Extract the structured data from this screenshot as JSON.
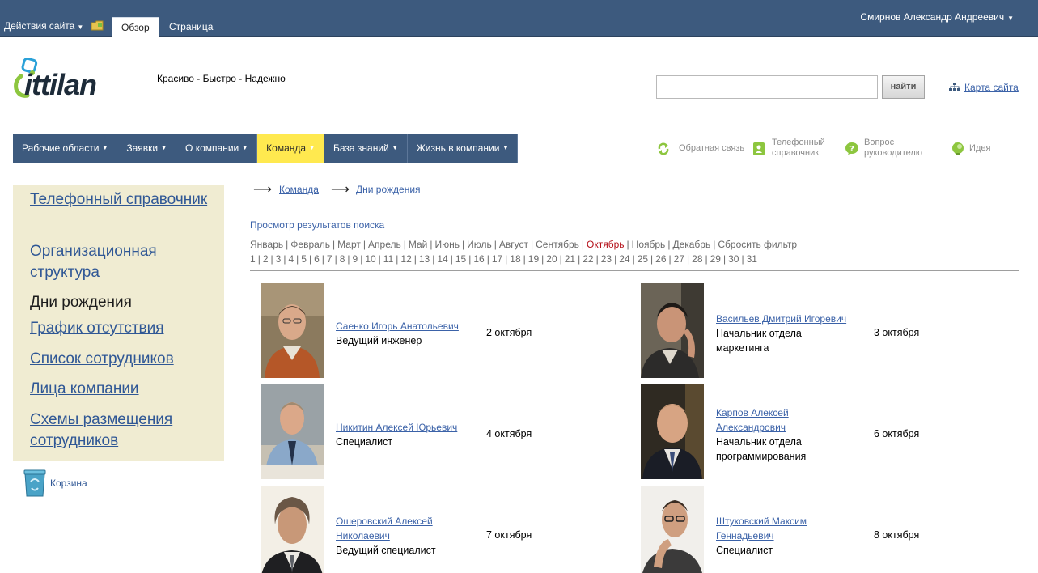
{
  "ribbon": {
    "site_actions": "Действия сайта",
    "tabs": [
      "Обзор",
      "Страница"
    ],
    "user": "Смирнов Александр Андреевич"
  },
  "header": {
    "logo_text": "ittilan",
    "slogan": "Красиво - Быстро - Надежно",
    "search_placeholder": "",
    "search_button": "найти",
    "sitemap": "Карта сайта"
  },
  "nav": {
    "items": [
      "Рабочие области",
      "Заявки",
      "О компании",
      "Команда",
      "База знаний",
      "Жизнь в компании"
    ],
    "active": "Команда"
  },
  "quick_links": [
    {
      "label": "Обратная связь",
      "icon": "recycle-arrows-icon"
    },
    {
      "label": "Телефонный справочник",
      "icon": "phonebook-icon"
    },
    {
      "label": "Вопрос руководителю",
      "icon": "question-bubble-icon"
    },
    {
      "label": "Идея",
      "icon": "idea-bulb-icon"
    }
  ],
  "sidebar": {
    "items": [
      "Телефонный справочник",
      "Организационная структура",
      "Дни рождения",
      "График отсутствия",
      "Список сотрудников",
      "Лица компании",
      "Схемы размещения сотрудников"
    ],
    "current": "Дни рождения",
    "trash": "Корзина"
  },
  "breadcrumb": [
    "Команда",
    "Дни рождения"
  ],
  "filter": {
    "title": "Просмотр результатов поиска",
    "months": [
      "Январь",
      "Февраль",
      "Март",
      "Апрель",
      "Май",
      "Июнь",
      "Июль",
      "Август",
      "Сентябрь",
      "Октябрь",
      "Ноябрь",
      "Декабрь"
    ],
    "selected_month": "Октябрь",
    "reset": "Сбросить фильтр",
    "days": [
      "1",
      "2",
      "3",
      "4",
      "5",
      "6",
      "7",
      "8",
      "9",
      "10",
      "11",
      "12",
      "13",
      "14",
      "15",
      "16",
      "17",
      "18",
      "19",
      "20",
      "21",
      "22",
      "23",
      "24",
      "25",
      "26",
      "27",
      "28",
      "29",
      "30",
      "31"
    ]
  },
  "employees": [
    {
      "name": "Саенко Игорь Анатольевич",
      "position": "Ведущий инженер",
      "date": "2 октября"
    },
    {
      "name": "Васильев Дмитрий Игоревич",
      "position": "Начальник отдела маркетинга",
      "date": "3 октября"
    },
    {
      "name": "Никитин Алексей Юрьевич",
      "position": "Специалист",
      "date": "4 октября"
    },
    {
      "name": "Карпов Алексей Александрович",
      "position": "Начальник отдела программирования",
      "date": "6 октября"
    },
    {
      "name": "Ошеровский Алексей Николаевич",
      "position": "Ведущий специалист",
      "date": "7 октября"
    },
    {
      "name": "Штуковский Максим Геннадьевич",
      "position": "Специалист",
      "date": "8 октября"
    }
  ],
  "colors": {
    "ribbon": "#3d5a7e",
    "nav_active": "#ffe94f",
    "sidebar_bg": "#f0ecd2",
    "link": "#3b62a8",
    "selected_month": "#b5121b"
  }
}
